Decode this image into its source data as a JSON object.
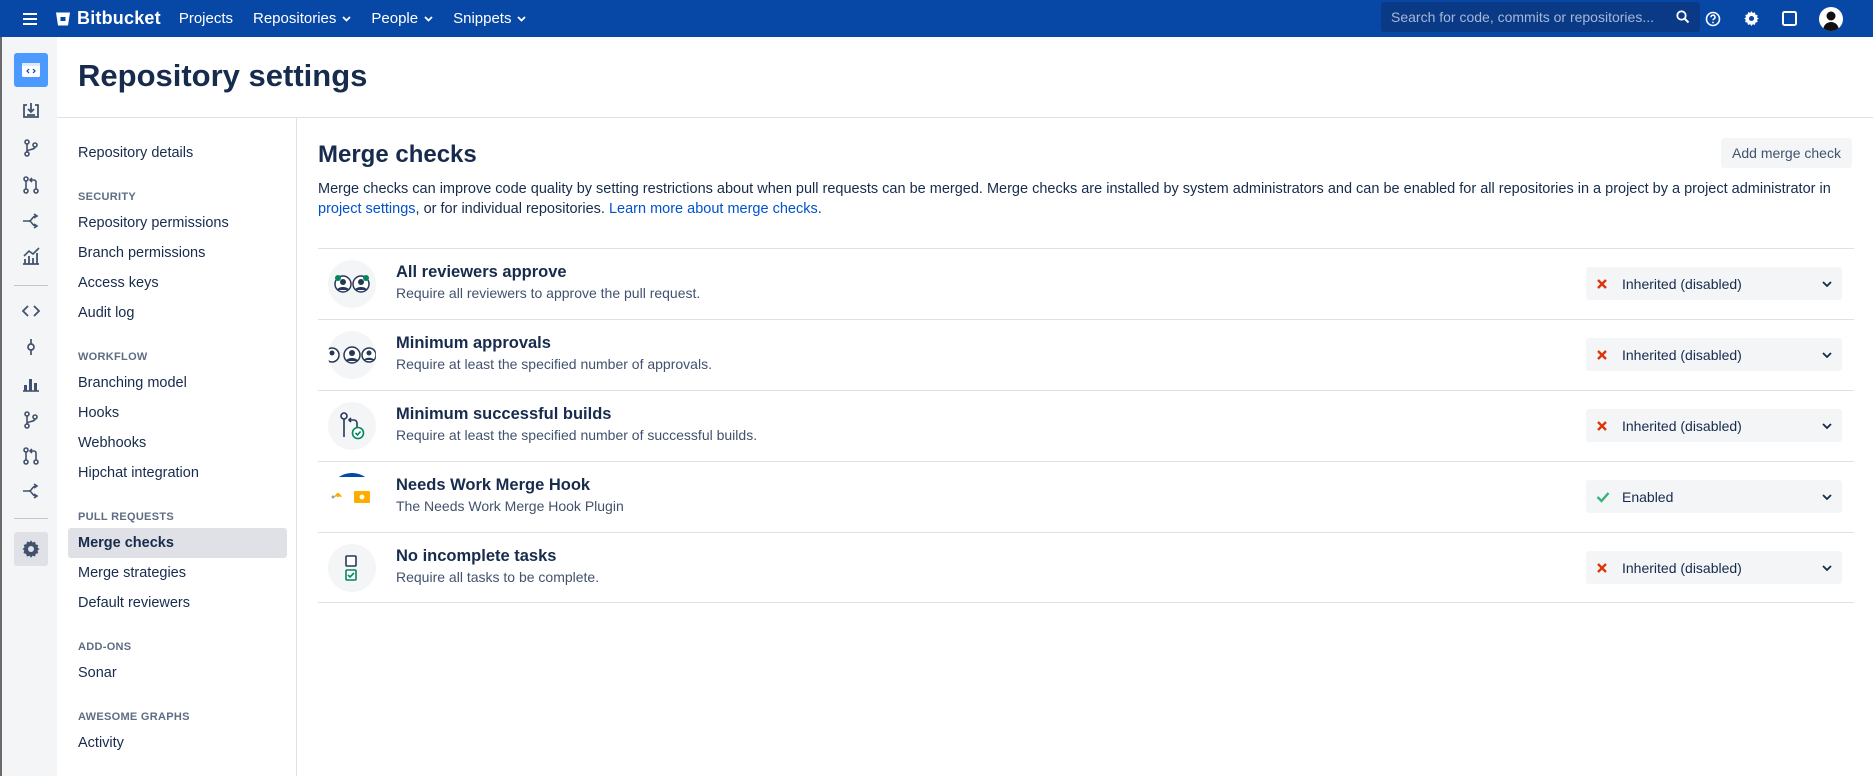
{
  "topbar": {
    "brand": "Bitbucket",
    "nav": [
      {
        "label": "Projects",
        "dropdown": false
      },
      {
        "label": "Repositories",
        "dropdown": true
      },
      {
        "label": "People",
        "dropdown": true
      },
      {
        "label": "Snippets",
        "dropdown": true
      }
    ],
    "search_placeholder": "Search for code, commits or repositories...",
    "icons": [
      "help-icon",
      "gear-icon",
      "notifications-icon",
      "avatar"
    ]
  },
  "rail": {
    "icons": [
      "repository-icon",
      "clone-icon",
      "create-branch-icon",
      "create-pull-request-icon",
      "fork-icon",
      "insights-icon",
      "source-icon",
      "commits-icon",
      "graphs-icon",
      "branches-icon",
      "pull-requests-icon",
      "forks-icon",
      "settings-icon"
    ]
  },
  "page": {
    "title": "Repository settings"
  },
  "sidenav": {
    "top_link": "Repository details",
    "sections": [
      {
        "heading": "SECURITY",
        "items": [
          "Repository permissions",
          "Branch permissions",
          "Access keys",
          "Audit log"
        ]
      },
      {
        "heading": "WORKFLOW",
        "items": [
          "Branching model",
          "Hooks",
          "Webhooks",
          "Hipchat integration"
        ]
      },
      {
        "heading": "PULL REQUESTS",
        "items": [
          "Merge checks",
          "Merge strategies",
          "Default reviewers"
        ]
      },
      {
        "heading": "ADD-ONS",
        "items": [
          "Sonar"
        ]
      },
      {
        "heading": "AWESOME GRAPHS",
        "items": [
          "Activity"
        ]
      }
    ],
    "active": "Merge checks"
  },
  "main": {
    "title": "Merge checks",
    "add_button": "Add merge check",
    "description_pre": "Merge checks can improve code quality by setting restrictions about when pull requests can be merged. Merge checks are installed by system administrators and can be enabled for all repositories in a project by a project administrator in ",
    "description_link1": "project settings",
    "description_mid": ", or for individual repositories. ",
    "description_link2": "Learn more about merge checks",
    "description_post": ".",
    "checks": [
      {
        "name": "All reviewers approve",
        "description": "Require all reviewers to approve the pull request.",
        "status": "Inherited (disabled)",
        "enabled": false
      },
      {
        "name": "Minimum approvals",
        "description": "Require at least the specified number of approvals.",
        "status": "Inherited (disabled)",
        "enabled": false
      },
      {
        "name": "Minimum successful builds",
        "description": "Require at least the specified number of successful builds.",
        "status": "Inherited (disabled)",
        "enabled": false
      },
      {
        "name": "Needs Work Merge Hook",
        "description": "The Needs Work Merge Hook Plugin",
        "status": "Enabled",
        "enabled": true
      },
      {
        "name": "No incomplete tasks",
        "description": "Require all tasks to be complete.",
        "status": "Inherited (disabled)",
        "enabled": false
      }
    ]
  },
  "colors": {
    "topbar": "#0747a6",
    "link": "#0052cc",
    "disabled_x": "#de350b",
    "enabled_check": "#36b37e"
  }
}
